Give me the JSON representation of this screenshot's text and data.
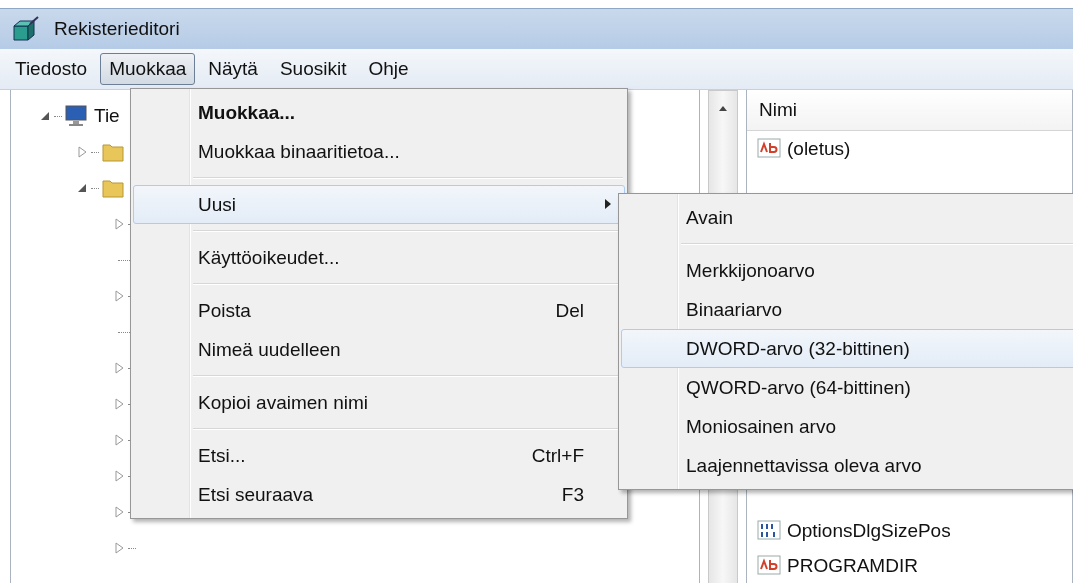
{
  "window": {
    "title": "Rekisterieditori"
  },
  "menu_bar": [
    {
      "label": "Tiedosto",
      "selected": false
    },
    {
      "label": "Muokkaa",
      "selected": true
    },
    {
      "label": "Näytä",
      "selected": false
    },
    {
      "label": "Suosikit",
      "selected": false
    },
    {
      "label": "Ohje",
      "selected": false
    }
  ],
  "tree": {
    "items": [
      {
        "label": "Tie",
        "kind": "computer",
        "expanded": true,
        "children": [
          {
            "kind": "folder",
            "expanded": false
          },
          {
            "kind": "folder",
            "expanded": true,
            "children": [
              {
                "expanded": false
              },
              {
                "kind": "connector"
              },
              {
                "expanded": false
              },
              {
                "kind": "connector"
              },
              {
                "expanded": false
              },
              {
                "expanded": false
              },
              {
                "expanded": false
              },
              {
                "expanded": false
              },
              {
                "expanded": false
              },
              {
                "expanded": false
              }
            ]
          }
        ]
      }
    ]
  },
  "values_list": {
    "columns": [
      {
        "label": "Nimi"
      }
    ],
    "rows_top": [
      {
        "name": "(oletus)",
        "kind": "string"
      }
    ],
    "rows_bottom": [
      {
        "name": "OptionsDlgSizePos",
        "kind": "binary"
      },
      {
        "name": "PROGRAMDIR",
        "kind": "string"
      }
    ]
  },
  "edit_menu": {
    "items": [
      {
        "kind": "item",
        "label": "Muokkaa...",
        "default": true
      },
      {
        "kind": "item",
        "label": "Muokkaa binaaritietoa...",
        "default": false
      },
      {
        "kind": "separator"
      },
      {
        "kind": "submenu",
        "label": "Uusi",
        "selected": true
      },
      {
        "kind": "separator"
      },
      {
        "kind": "item",
        "label": "Käyttöoikeudet...",
        "default": false
      },
      {
        "kind": "separator"
      },
      {
        "kind": "item",
        "label": "Poista",
        "shortcut": "Del",
        "default": false
      },
      {
        "kind": "item",
        "label": "Nimeä uudelleen",
        "default": false
      },
      {
        "kind": "separator"
      },
      {
        "kind": "item",
        "label": "Kopioi avaimen nimi",
        "default": false
      },
      {
        "kind": "separator"
      },
      {
        "kind": "item",
        "label": "Etsi...",
        "shortcut": "Ctrl+F",
        "default": false
      },
      {
        "kind": "item",
        "label": "Etsi seuraava",
        "shortcut": "F3",
        "default": false
      }
    ]
  },
  "new_submenu": {
    "items": [
      {
        "kind": "item",
        "label": "Avain",
        "selected": false
      },
      {
        "kind": "separator"
      },
      {
        "kind": "item",
        "label": "Merkkijonoarvo",
        "selected": false
      },
      {
        "kind": "item",
        "label": "Binaariarvo",
        "selected": false
      },
      {
        "kind": "item",
        "label": "DWORD-arvo (32-bittinen)",
        "selected": true
      },
      {
        "kind": "item",
        "label": "QWORD-arvo (64-bittinen)",
        "selected": false
      },
      {
        "kind": "item",
        "label": "Moniosainen arvo",
        "selected": false
      },
      {
        "kind": "item",
        "label": "Laajennettavissa oleva arvo",
        "selected": false
      }
    ]
  }
}
